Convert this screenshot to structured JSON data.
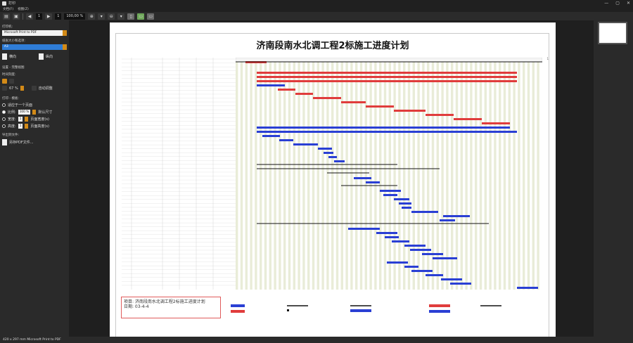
{
  "window": {
    "title": "打印",
    "minimize": "—",
    "maximize": "▢",
    "close": "✕"
  },
  "menu": {
    "items": [
      "文档(F)",
      "视图(Z)"
    ]
  },
  "toolbar": {
    "page": "1",
    "page_total": "1",
    "zoom": "100,00 %"
  },
  "left_panel": {
    "printer_label": "打印机:",
    "printer_value": "Microsoft Print to PDF",
    "paper_label": "纸张大小和选项:",
    "paper_value": "A3",
    "portrait": "横向",
    "landscape": "纵向",
    "settings_label": "设置 - 完整视图",
    "timescale_label": "时间刻度:",
    "timescale_value": "67 %",
    "auto_fit": "自动调整",
    "print_label": "打印 - 模板:",
    "fit_one_page": "适应于一个页面",
    "scale_label": "比例:",
    "scale_value": "100 %",
    "default_size": "默认尺寸",
    "width_label": "宽度:",
    "width_value": "1",
    "width_unit": "页面宽度(s)",
    "height_label": "高度:",
    "height_value": "1",
    "height_unit": "页面高度(s)",
    "export_label": "导出到文件:",
    "export_btn": "另存PDF文件..."
  },
  "document": {
    "title": "济南段南水北调工程2标施工进度计划",
    "page_label": "1",
    "info_project": "项目: 济南段南水北调工程2标施工进度计划",
    "info_date": "日期: 03-4-4"
  },
  "status": {
    "text": "420 x 297 mm Microsoft Print to PDF"
  },
  "colors": {
    "accent": "#2f7dd7",
    "orange": "#d28a18",
    "bar_red": "#e03c3c",
    "bar_blue": "#2a3fd4"
  }
}
